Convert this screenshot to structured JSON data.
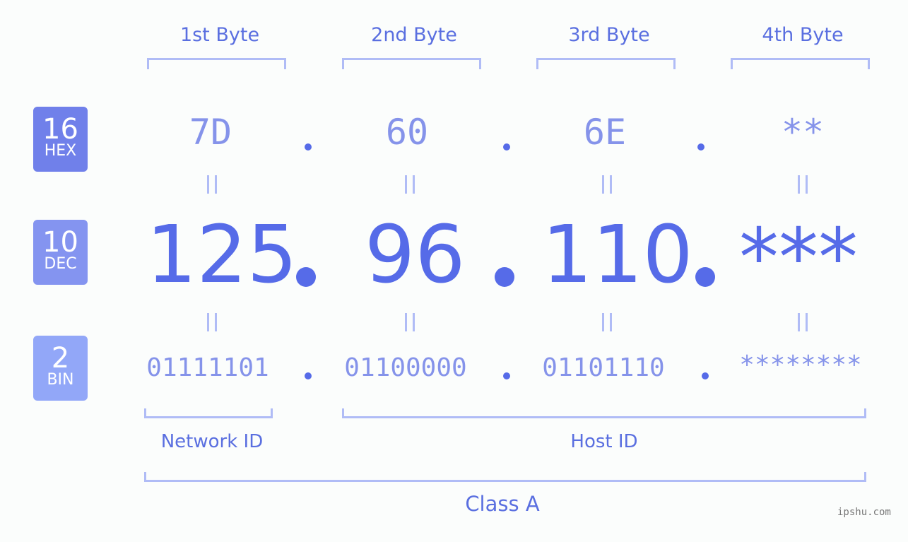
{
  "bytes": [
    {
      "label": "1st Byte",
      "hex": "7D",
      "dec": "125",
      "bin": "01111101"
    },
    {
      "label": "2nd Byte",
      "hex": "60",
      "dec": "96",
      "bin": "01100000"
    },
    {
      "label": "3rd Byte",
      "hex": "6E",
      "dec": "110",
      "bin": "01101110"
    },
    {
      "label": "4th Byte",
      "hex": "**",
      "dec": "***",
      "bin": "********"
    }
  ],
  "badges": {
    "hex": {
      "num": "16",
      "label": "HEX",
      "color": "#7080ea"
    },
    "dec": {
      "num": "10",
      "label": "DEC",
      "color": "#8494f0"
    },
    "bin": {
      "num": "2",
      "label": "BIN",
      "color": "#92a7f8"
    }
  },
  "sections": {
    "network": "Network ID",
    "host": "Host ID",
    "class": "Class A"
  },
  "watermark": "ipshu.com"
}
